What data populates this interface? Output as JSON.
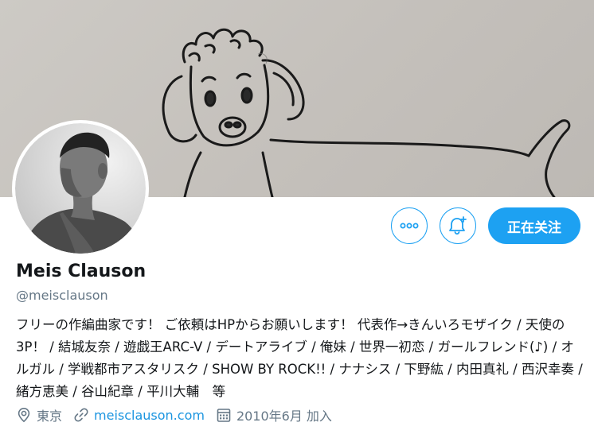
{
  "profile": {
    "display_name": "Meis Clauson",
    "handle": "@meisclauson",
    "bio": "フリーの作編曲家です！ ご依頼はHPからお願いします！ 代表作→きんいろモザイク / 天使の3P！ / 結城友奈 / 遊戯王ARC-V / デートアライブ / 俺妹 / 世界一初恋 / ガールフレンド(♪) / オルガル / 学戦都市アスタリスク / SHOW BY ROCK!! / ナナシス / 下野紘 / 内田真礼 / 西沢幸奏 / 緒方恵美 / 谷山紀章 / 平川大輔　等",
    "location": "東京",
    "website": "meisclauson.com",
    "joined": "2010年6月 加入"
  },
  "actions": {
    "more_icon": "more-dots-icon",
    "bell_icon": "bell-plus-icon",
    "follow_label": "正在关注"
  },
  "colors": {
    "accent": "#1da1f2",
    "secondary_text": "#657786",
    "primary_text": "#14171a",
    "link": "#1b95e0"
  }
}
